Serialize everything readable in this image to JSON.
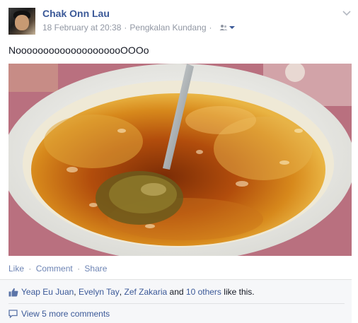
{
  "post": {
    "author": "Chak Onn Lau",
    "timestamp": "18 February at 20:38",
    "location": "Pengkalan Kundang",
    "separator": "·",
    "status_text": "NoooooooooooooooooooOOOo",
    "icons": {
      "audience": "friends-icon",
      "menu": "chevron-down-icon",
      "like": "thumbs-up-icon",
      "comment": "comment-icon"
    },
    "photo": {
      "description_kind": "food-photo"
    }
  },
  "actions": {
    "like": "Like",
    "comment": "Comment",
    "share": "Share",
    "dot": "·"
  },
  "feedback": {
    "liker_1": "Yeap Eu Juan",
    "liker_2": "Evelyn Tay",
    "liker_3": "Zef Zakaria",
    "comma": ",",
    "and": "and",
    "others": "10 others",
    "suffix": "like this.",
    "view_more": "View 5 more comments"
  },
  "colors": {
    "link": "#3b5998",
    "meta": "#9197a3",
    "action_link": "#6d84b4",
    "feedback_bg": "#f6f7f9"
  }
}
